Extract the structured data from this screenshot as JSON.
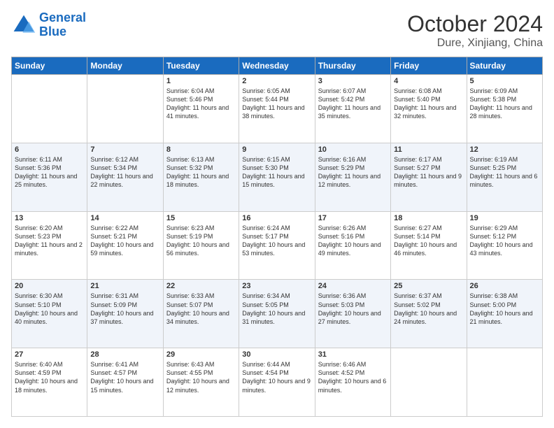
{
  "header": {
    "logo_line1": "General",
    "logo_line2": "Blue",
    "month": "October 2024",
    "location": "Dure, Xinjiang, China"
  },
  "days_of_week": [
    "Sunday",
    "Monday",
    "Tuesday",
    "Wednesday",
    "Thursday",
    "Friday",
    "Saturday"
  ],
  "weeks": [
    [
      {
        "day": "",
        "info": ""
      },
      {
        "day": "",
        "info": ""
      },
      {
        "day": "1",
        "info": "Sunrise: 6:04 AM\nSunset: 5:46 PM\nDaylight: 11 hours and 41 minutes."
      },
      {
        "day": "2",
        "info": "Sunrise: 6:05 AM\nSunset: 5:44 PM\nDaylight: 11 hours and 38 minutes."
      },
      {
        "day": "3",
        "info": "Sunrise: 6:07 AM\nSunset: 5:42 PM\nDaylight: 11 hours and 35 minutes."
      },
      {
        "day": "4",
        "info": "Sunrise: 6:08 AM\nSunset: 5:40 PM\nDaylight: 11 hours and 32 minutes."
      },
      {
        "day": "5",
        "info": "Sunrise: 6:09 AM\nSunset: 5:38 PM\nDaylight: 11 hours and 28 minutes."
      }
    ],
    [
      {
        "day": "6",
        "info": "Sunrise: 6:11 AM\nSunset: 5:36 PM\nDaylight: 11 hours and 25 minutes."
      },
      {
        "day": "7",
        "info": "Sunrise: 6:12 AM\nSunset: 5:34 PM\nDaylight: 11 hours and 22 minutes."
      },
      {
        "day": "8",
        "info": "Sunrise: 6:13 AM\nSunset: 5:32 PM\nDaylight: 11 hours and 18 minutes."
      },
      {
        "day": "9",
        "info": "Sunrise: 6:15 AM\nSunset: 5:30 PM\nDaylight: 11 hours and 15 minutes."
      },
      {
        "day": "10",
        "info": "Sunrise: 6:16 AM\nSunset: 5:29 PM\nDaylight: 11 hours and 12 minutes."
      },
      {
        "day": "11",
        "info": "Sunrise: 6:17 AM\nSunset: 5:27 PM\nDaylight: 11 hours and 9 minutes."
      },
      {
        "day": "12",
        "info": "Sunrise: 6:19 AM\nSunset: 5:25 PM\nDaylight: 11 hours and 6 minutes."
      }
    ],
    [
      {
        "day": "13",
        "info": "Sunrise: 6:20 AM\nSunset: 5:23 PM\nDaylight: 11 hours and 2 minutes."
      },
      {
        "day": "14",
        "info": "Sunrise: 6:22 AM\nSunset: 5:21 PM\nDaylight: 10 hours and 59 minutes."
      },
      {
        "day": "15",
        "info": "Sunrise: 6:23 AM\nSunset: 5:19 PM\nDaylight: 10 hours and 56 minutes."
      },
      {
        "day": "16",
        "info": "Sunrise: 6:24 AM\nSunset: 5:17 PM\nDaylight: 10 hours and 53 minutes."
      },
      {
        "day": "17",
        "info": "Sunrise: 6:26 AM\nSunset: 5:16 PM\nDaylight: 10 hours and 49 minutes."
      },
      {
        "day": "18",
        "info": "Sunrise: 6:27 AM\nSunset: 5:14 PM\nDaylight: 10 hours and 46 minutes."
      },
      {
        "day": "19",
        "info": "Sunrise: 6:29 AM\nSunset: 5:12 PM\nDaylight: 10 hours and 43 minutes."
      }
    ],
    [
      {
        "day": "20",
        "info": "Sunrise: 6:30 AM\nSunset: 5:10 PM\nDaylight: 10 hours and 40 minutes."
      },
      {
        "day": "21",
        "info": "Sunrise: 6:31 AM\nSunset: 5:09 PM\nDaylight: 10 hours and 37 minutes."
      },
      {
        "day": "22",
        "info": "Sunrise: 6:33 AM\nSunset: 5:07 PM\nDaylight: 10 hours and 34 minutes."
      },
      {
        "day": "23",
        "info": "Sunrise: 6:34 AM\nSunset: 5:05 PM\nDaylight: 10 hours and 31 minutes."
      },
      {
        "day": "24",
        "info": "Sunrise: 6:36 AM\nSunset: 5:03 PM\nDaylight: 10 hours and 27 minutes."
      },
      {
        "day": "25",
        "info": "Sunrise: 6:37 AM\nSunset: 5:02 PM\nDaylight: 10 hours and 24 minutes."
      },
      {
        "day": "26",
        "info": "Sunrise: 6:38 AM\nSunset: 5:00 PM\nDaylight: 10 hours and 21 minutes."
      }
    ],
    [
      {
        "day": "27",
        "info": "Sunrise: 6:40 AM\nSunset: 4:59 PM\nDaylight: 10 hours and 18 minutes."
      },
      {
        "day": "28",
        "info": "Sunrise: 6:41 AM\nSunset: 4:57 PM\nDaylight: 10 hours and 15 minutes."
      },
      {
        "day": "29",
        "info": "Sunrise: 6:43 AM\nSunset: 4:55 PM\nDaylight: 10 hours and 12 minutes."
      },
      {
        "day": "30",
        "info": "Sunrise: 6:44 AM\nSunset: 4:54 PM\nDaylight: 10 hours and 9 minutes."
      },
      {
        "day": "31",
        "info": "Sunrise: 6:46 AM\nSunset: 4:52 PM\nDaylight: 10 hours and 6 minutes."
      },
      {
        "day": "",
        "info": ""
      },
      {
        "day": "",
        "info": ""
      }
    ]
  ],
  "colors": {
    "header_bg": "#1a6bbf",
    "odd_row": "#ffffff",
    "even_row": "#f0f4fa"
  }
}
